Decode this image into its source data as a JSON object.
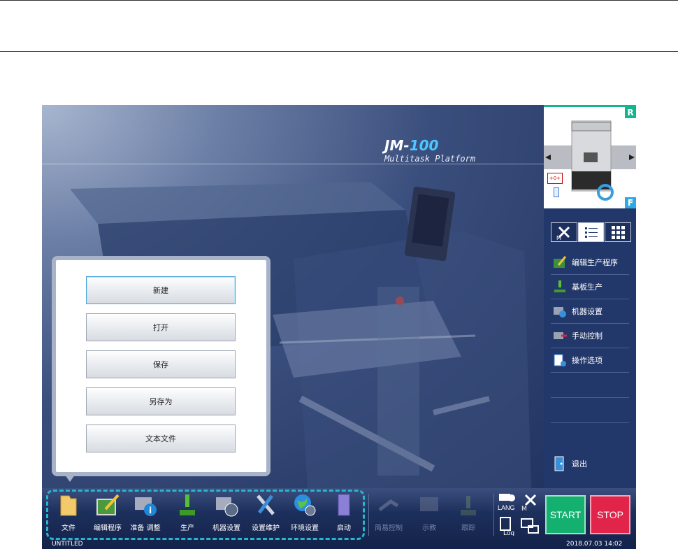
{
  "brand": {
    "model_prefix": "JM-",
    "model_number": "100",
    "subtitle": "Multitask Platform"
  },
  "feeder_view": {
    "rear_label": "R",
    "front_label": "F",
    "origin_button": "+0+"
  },
  "mode_tabs": [
    {
      "icon": "manual-tools-icon"
    },
    {
      "icon": "list-view-icon",
      "active": true
    },
    {
      "icon": "grid-view-icon"
    }
  ],
  "right_menu": {
    "items": [
      {
        "label": "编辑生产程序",
        "icon": "edit-program-icon"
      },
      {
        "label": "基板生产",
        "icon": "production-icon"
      },
      {
        "label": "机器设置",
        "icon": "machine-setting-icon"
      },
      {
        "label": "手动控制",
        "icon": "manual-control-icon"
      },
      {
        "label": "操作选项",
        "icon": "operation-options-icon"
      }
    ],
    "exit_label": "退出"
  },
  "file_popup": {
    "buttons": [
      "新建",
      "打开",
      "保存",
      "另存为",
      "文本文件"
    ]
  },
  "toolbar": {
    "main_buttons": [
      {
        "label": "文件",
        "icon": "folder-icon"
      },
      {
        "label": "编辑程序",
        "icon": "edit-program-icon"
      },
      {
        "label": "准备 调整",
        "icon": "prepare-adjust-icon"
      },
      {
        "label": "生产",
        "icon": "production-icon"
      },
      {
        "label": "机器设置",
        "icon": "machine-setting-icon"
      },
      {
        "label": "设置维护",
        "icon": "maintenance-icon"
      },
      {
        "label": "环境设置",
        "icon": "environment-icon"
      },
      {
        "label": "启动",
        "icon": "book-icon"
      }
    ],
    "disabled_buttons": [
      {
        "label": "简易控制",
        "icon": "easy-control-icon"
      },
      {
        "label": "示教",
        "icon": "teaching-icon"
      },
      {
        "label": "跟踪",
        "icon": "trace-icon"
      }
    ],
    "small_tools": [
      {
        "label": "LANG",
        "icon": "language-icon"
      },
      {
        "label": "M",
        "icon": "manual-tools-icon"
      },
      {
        "label": "Log",
        "icon": "log-icon"
      },
      {
        "label": "",
        "icon": "monitor-icon"
      }
    ],
    "start_label": "START",
    "stop_label": "STOP"
  },
  "status": {
    "file_name": "UNTITLED",
    "datetime": "2018.07.03 14:02"
  },
  "colors": {
    "start": "#14b070",
    "stop": "#e0244a",
    "accent_dashed": "#27b6cc",
    "rear": "#14b58c",
    "front": "#2ea9e6"
  }
}
